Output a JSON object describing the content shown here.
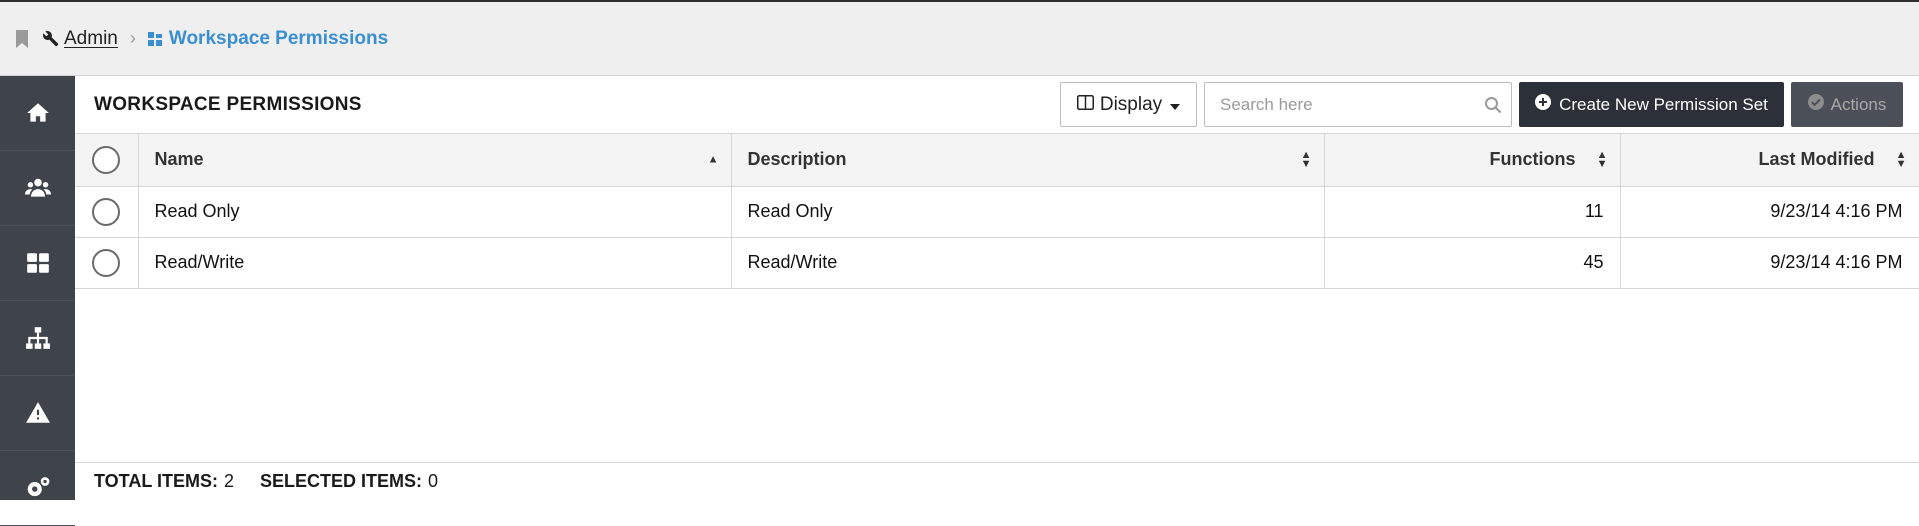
{
  "breadcrumb": {
    "admin_label": "Admin",
    "separator": "›",
    "current_label": "Workspace Permissions"
  },
  "sidenav": {
    "items": [
      {
        "icon": "home-icon"
      },
      {
        "icon": "users-icon"
      },
      {
        "icon": "dashboard-icon"
      },
      {
        "icon": "hierarchy-icon"
      },
      {
        "icon": "warning-icon"
      },
      {
        "icon": "gears-icon"
      }
    ]
  },
  "page": {
    "title": "WORKSPACE PERMISSIONS",
    "display_label": "Display",
    "search_placeholder": "Search here",
    "create_label": "Create New Permission Set",
    "actions_label": "Actions"
  },
  "table": {
    "columns": [
      "Name",
      "Description",
      "Functions",
      "Last Modified"
    ],
    "rows": [
      {
        "name": "Read Only",
        "description": "Read Only",
        "functions": "11",
        "last_modified": "9/23/14 4:16 PM"
      },
      {
        "name": "Read/Write",
        "description": "Read/Write",
        "functions": "45",
        "last_modified": "9/23/14 4:16 PM"
      }
    ]
  },
  "footer": {
    "total_label": "TOTAL ITEMS:",
    "total_value": "2",
    "selected_label": "SELECTED ITEMS:",
    "selected_value": "0"
  },
  "colors": {
    "accent": "#3a8fd0",
    "nav_bg": "#3f434a",
    "primary_button": "#2c3038",
    "disabled_button": "#4b4f57"
  }
}
